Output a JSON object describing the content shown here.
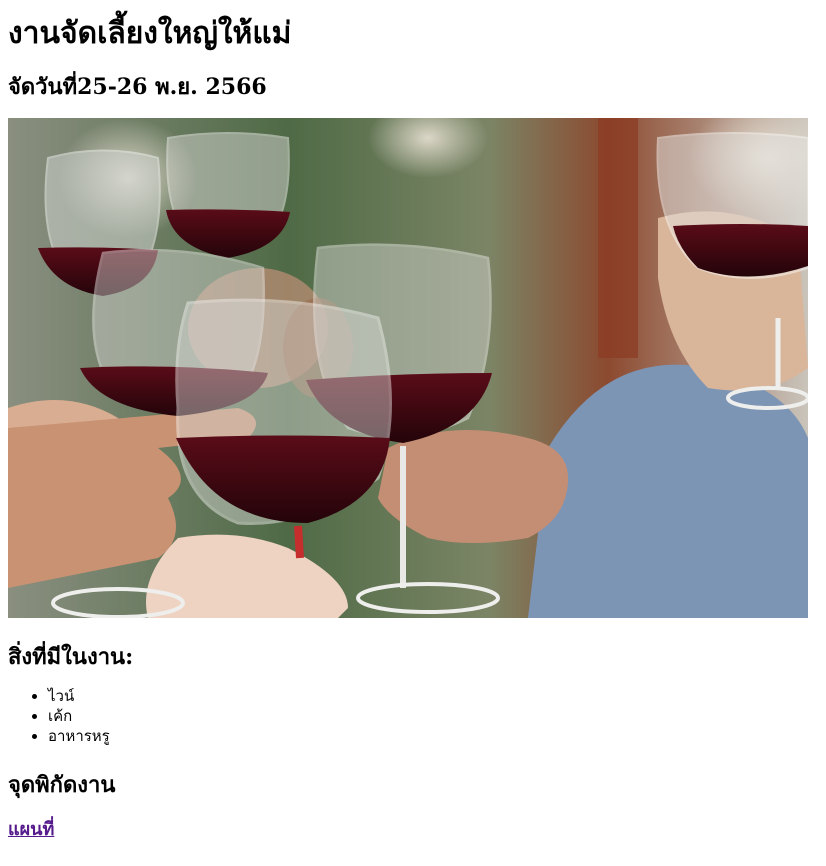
{
  "page": {
    "title": "งานจัดเลี้ยงใหญ่ให้แม่",
    "date": "จัดวันที่25-26 พ.ย. 2566"
  },
  "photo": {
    "alt": "wine glasses toast"
  },
  "items_section": {
    "heading": "สิ่งที่มีในงาน:",
    "items": [
      "ไวน์",
      "เค้ก",
      "อาหารหรู"
    ]
  },
  "location_section": {
    "heading": "จุดพิกัดงาน",
    "link_label": "แผนที่"
  }
}
